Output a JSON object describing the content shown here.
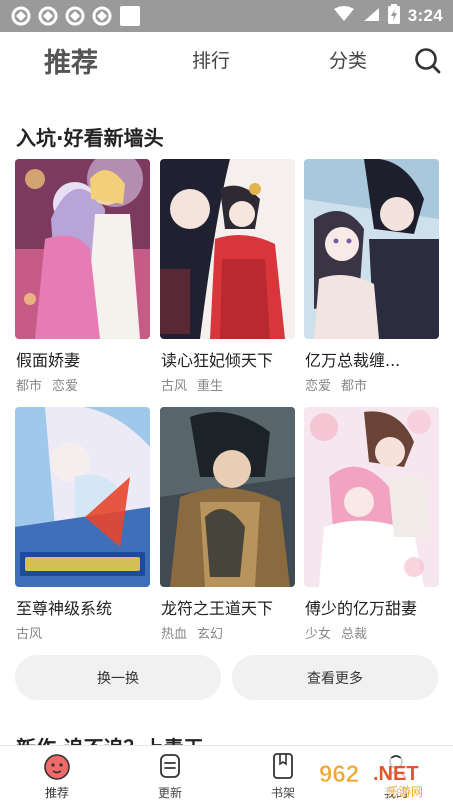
{
  "status_bar": {
    "time": "3:24"
  },
  "top_nav": {
    "tabs": [
      {
        "label": "推荐",
        "active": true
      },
      {
        "label": "排行",
        "active": false
      },
      {
        "label": "分类",
        "active": false
      }
    ],
    "search_icon": "search-icon"
  },
  "section": {
    "title": "入坑·好看新墙头",
    "items": [
      {
        "title": "假面娇妻",
        "tags": [
          "都市",
          "恋爱"
        ],
        "cover_colors": [
          "#e9b6d9",
          "#b877c9",
          "#f3d6a4"
        ]
      },
      {
        "title": "读心狂妃倾天下",
        "tags": [
          "古风",
          "重生"
        ],
        "cover_colors": [
          "#f7f1ee",
          "#2a2a3a",
          "#d8363a"
        ]
      },
      {
        "title": "亿万总裁缠...",
        "tags": [
          "恋爱",
          "都市"
        ],
        "cover_colors": [
          "#cfe2ee",
          "#2b2d3e",
          "#f1e4e1"
        ]
      },
      {
        "title": "至尊神级系统",
        "tags": [
          "古风"
        ],
        "cover_colors": [
          "#9fc8ea",
          "#e9e6f6",
          "#e8462c"
        ]
      },
      {
        "title": "龙符之王道天下",
        "tags": [
          "热血",
          "玄幻"
        ],
        "cover_colors": [
          "#3f4a52",
          "#8a6a3e",
          "#1c2328"
        ]
      },
      {
        "title": "傅少的亿万甜妻",
        "tags": [
          "少女",
          "总裁"
        ],
        "cover_colors": [
          "#f6e7ef",
          "#f2a3c2",
          "#6a4336"
        ]
      }
    ]
  },
  "buttons": {
    "refresh": "换一换",
    "more": "查看更多"
  },
  "next_section": {
    "title": "新作·追不追？上青天"
  },
  "bottom_nav": {
    "items": [
      {
        "label": "推荐",
        "icon": "home-icon",
        "active": true
      },
      {
        "label": "更新",
        "icon": "update-icon",
        "active": false
      },
      {
        "label": "书架",
        "icon": "bookshelf-icon",
        "active": false
      },
      {
        "label": "我的",
        "icon": "profile-icon",
        "active": false
      }
    ]
  },
  "watermark": {
    "text": "962.NET",
    "subtext": "乐游网"
  }
}
